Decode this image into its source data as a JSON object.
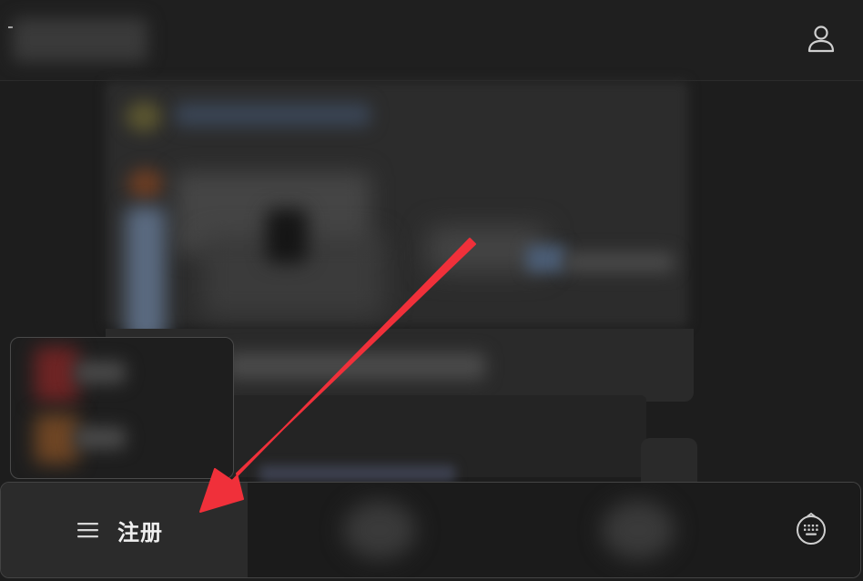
{
  "bottom_bar": {
    "register_label": "注册"
  },
  "icons": {
    "account": "user-account-icon",
    "menu": "menu-icon",
    "keyboard": "keyboard-icon",
    "annotation": "red-arrow"
  },
  "colors": {
    "annotation_arrow": "#f0303a",
    "background": "#1d1d1d",
    "bottom_bar": "#2b2b2b",
    "text": "#efefef"
  }
}
